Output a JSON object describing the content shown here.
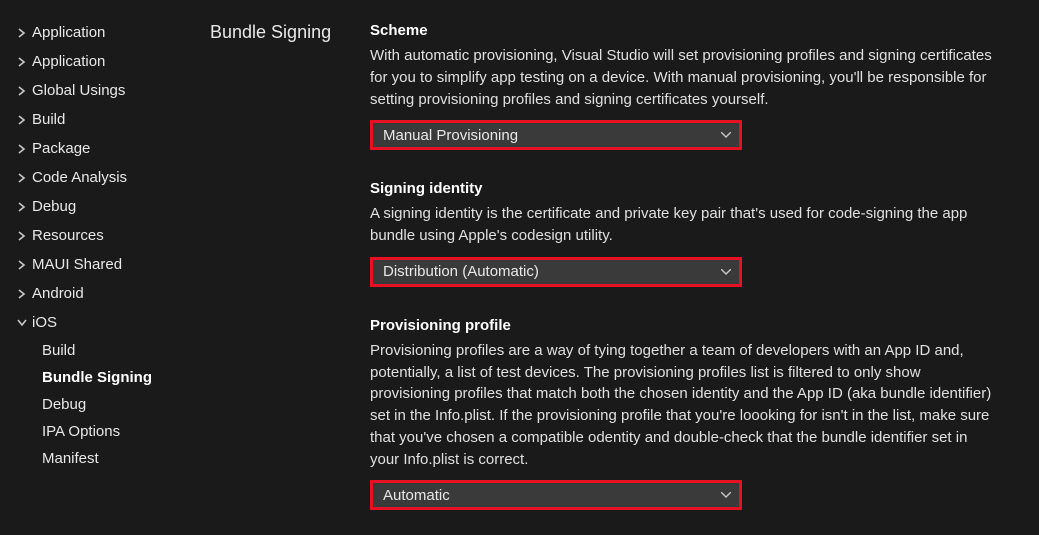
{
  "sidebar": {
    "items": [
      {
        "label": "Application",
        "expanded": false
      },
      {
        "label": "Application",
        "expanded": false
      },
      {
        "label": "Global Usings",
        "expanded": false
      },
      {
        "label": "Build",
        "expanded": false
      },
      {
        "label": "Package",
        "expanded": false
      },
      {
        "label": "Code Analysis",
        "expanded": false
      },
      {
        "label": "Debug",
        "expanded": false
      },
      {
        "label": "Resources",
        "expanded": false
      },
      {
        "label": "MAUI Shared",
        "expanded": false
      },
      {
        "label": "Android",
        "expanded": false
      },
      {
        "label": "iOS",
        "expanded": true,
        "children": [
          {
            "label": "Build",
            "active": false
          },
          {
            "label": "Bundle Signing",
            "active": true
          },
          {
            "label": "Debug",
            "active": false
          },
          {
            "label": "IPA Options",
            "active": false
          },
          {
            "label": "Manifest",
            "active": false
          }
        ]
      }
    ]
  },
  "section_title": "Bundle Signing",
  "fields": {
    "scheme": {
      "label": "Scheme",
      "desc": "With automatic provisioning, Visual Studio will set provisioning profiles and signing certificates for you to simplify app testing on a device. With manual provisioning, you'll be responsible for setting provisioning profiles and signing certificates yourself.",
      "value": "Manual Provisioning"
    },
    "signing_identity": {
      "label": "Signing identity",
      "desc": "A signing identity is the certificate and private key pair that's used for code-signing the app bundle using Apple's codesign utility.",
      "value": "Distribution (Automatic)"
    },
    "provisioning_profile": {
      "label": "Provisioning profile",
      "desc": "Provisioning profiles are a way of tying together a team of developers with an App ID and, potentially, a list of test devices. The provisioning profiles list is filtered to only show provisioning profiles that match both the chosen identity and the App ID (aka bundle identifier) set in the Info.plist. If the provisioning profile that you're loooking for isn't in the list, make sure that you've chosen a compatible odentity and double-check that the bundle identifier set in your Info.plist is correct.",
      "value": "Automatic"
    }
  },
  "colors": {
    "highlight": "#e81123",
    "bg": "#1a1a1a",
    "dropdown_bg": "#3a3a3a"
  }
}
